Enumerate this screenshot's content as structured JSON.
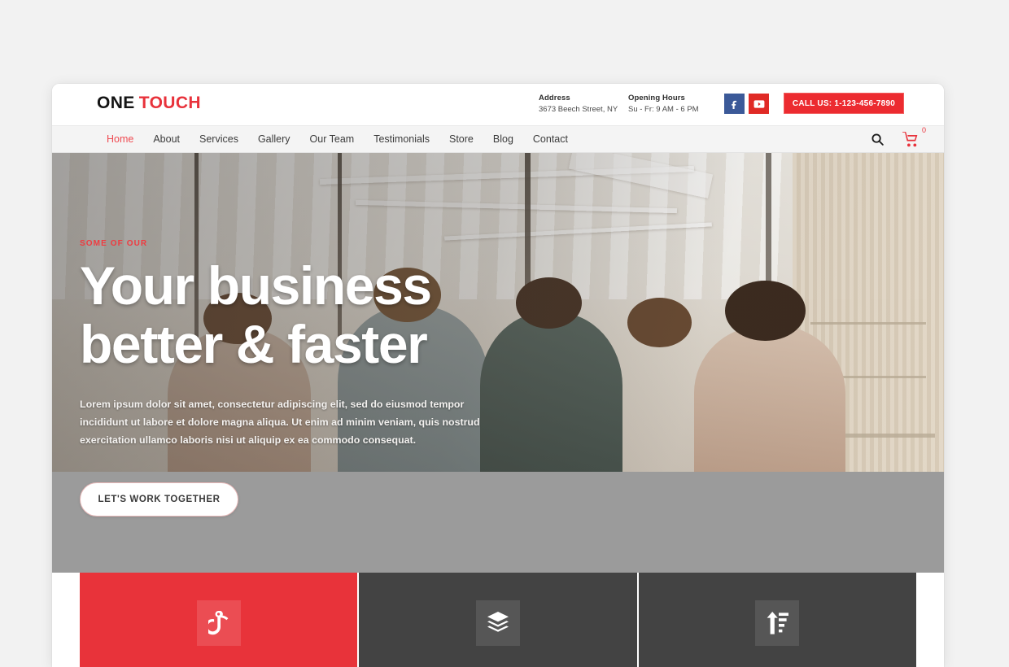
{
  "window": {
    "brand": {
      "first": "ONE",
      "second": "TOUCH"
    },
    "header": {
      "address_label": "Address",
      "address_value": "3673 Beech Street, NY",
      "hours_label": "Opening Hours",
      "hours_value": "Su - Fr: 9 AM - 6 PM",
      "call_button": "CALL US: 1-123-456-7890",
      "social": [
        {
          "name": "facebook-icon",
          "color": "#3b5998"
        },
        {
          "name": "youtube-icon",
          "color": "#e02a26"
        }
      ]
    },
    "nav": {
      "items": [
        {
          "label": "Home",
          "active": true
        },
        {
          "label": "About",
          "active": false
        },
        {
          "label": "Services",
          "active": false
        },
        {
          "label": "Gallery",
          "active": false
        },
        {
          "label": "Our Team",
          "active": false
        },
        {
          "label": "Testimonials",
          "active": false
        },
        {
          "label": "Store",
          "active": false
        },
        {
          "label": "Blog",
          "active": false
        },
        {
          "label": "Contact",
          "active": false
        }
      ],
      "search_icon": "search-icon",
      "cart_icon": "shopping-cart-icon",
      "cart_count": "0"
    },
    "hero": {
      "eyebrow": "SOME OF OUR",
      "headline_line1": "Your business",
      "headline_line2": "better & faster",
      "paragraph": "Lorem ipsum dolor sit amet, consectetur adipiscing elit, sed do eiusmod tempor incididunt ut labore et dolore magna aliqua. Ut enim ad minim veniam, quis nostrud exercitation ullamco laboris nisi ut aliquip ex ea commodo consequat.",
      "cta_label": "LET'S WORK TOGETHER"
    },
    "tiles": [
      {
        "icon": "one-finger-tap-icon",
        "style": "red"
      },
      {
        "icon": "layers-stack-icon",
        "style": "dark"
      },
      {
        "icon": "sort-ascending-icon",
        "style": "dark"
      }
    ],
    "colors": {
      "brand_red": "#e8323b",
      "accent_red": "#ef4b52",
      "dark_tile": "#434343",
      "band_gray": "#9b9b9b",
      "page_background": "#f2f2f2"
    }
  }
}
